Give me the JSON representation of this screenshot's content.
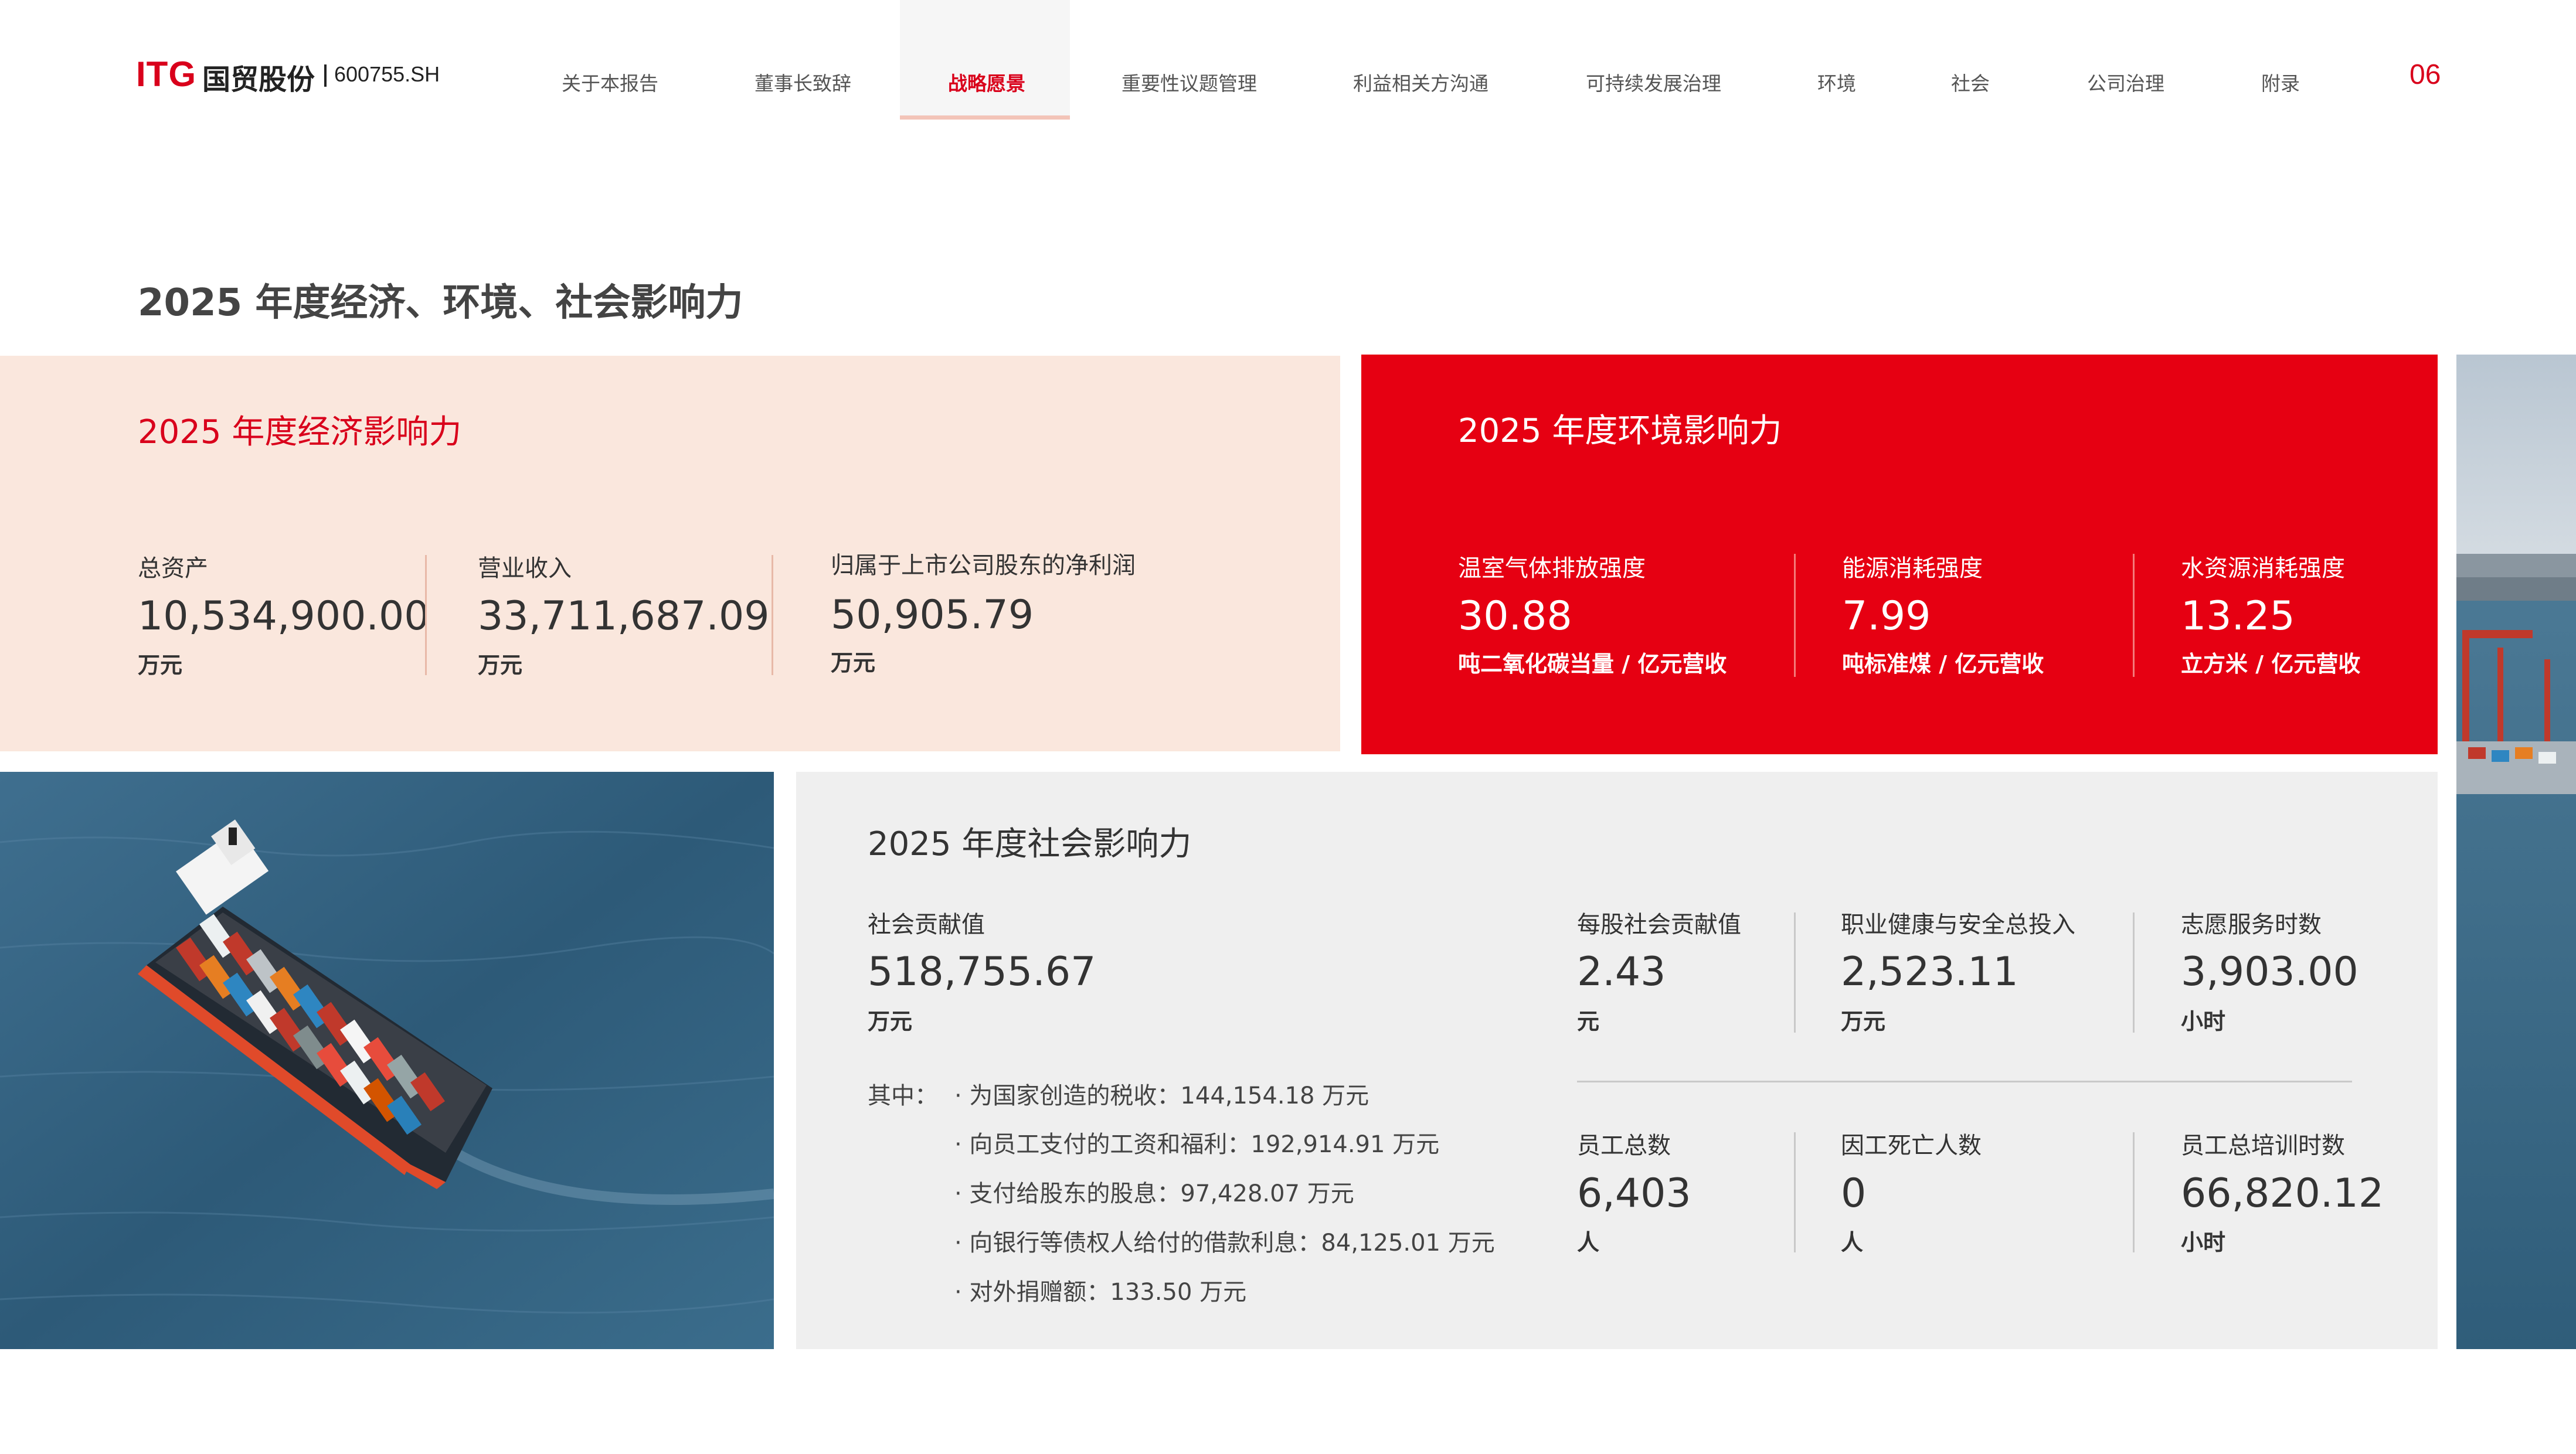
{
  "header": {
    "logo_mark": "ITG",
    "logo_name": "国贸股份",
    "stock_code": "600755.SH",
    "page_number": "06",
    "nav": [
      {
        "label": "关于本报告"
      },
      {
        "label": "董事长致辞"
      },
      {
        "label": "战略愿景",
        "active": true
      },
      {
        "label": "重要性议题管理"
      },
      {
        "label": "利益相关方沟通"
      },
      {
        "label": "可持续发展治理"
      },
      {
        "label": "环境"
      },
      {
        "label": "社会"
      },
      {
        "label": "公司治理"
      },
      {
        "label": "附录"
      }
    ]
  },
  "page_title": "2025 年度经济、环境、社会影响力",
  "economic": {
    "title": "2025 年度经济影响力",
    "metrics": [
      {
        "label": "总资产",
        "value": "10,534,900.00",
        "unit": "万元"
      },
      {
        "label": "营业收入",
        "value": "33,711,687.09",
        "unit": "万元"
      },
      {
        "label": "归属于上市公司股东的净利润",
        "value": "50,905.79",
        "unit": "万元"
      }
    ]
  },
  "environmental": {
    "title": "2025 年度环境影响力",
    "metrics": [
      {
        "label": "温室气体排放强度",
        "value": "30.88",
        "unit": "吨二氧化碳当量 / 亿元营收"
      },
      {
        "label": "能源消耗强度",
        "value": "7.99",
        "unit": "吨标准煤 / 亿元营收"
      },
      {
        "label": "水资源消耗强度",
        "value": "13.25",
        "unit": "立方米 / 亿元营收"
      }
    ]
  },
  "social": {
    "title": "2025 年度社会影响力",
    "contribution": {
      "label": "社会贡献值",
      "value": "518,755.67",
      "unit": "万元"
    },
    "breakdown_prefix": "其中：",
    "breakdown": [
      "· 为国家创造的税收：144,154.18 万元",
      "· 向员工支付的工资和福利：192,914.91 万元",
      "· 支付给股东的股息：97,428.07 万元",
      "· 向银行等债权人给付的借款利息：84,125.01 万元",
      "· 对外捐赠额：133.50 万元"
    ],
    "metrics_top": [
      {
        "label": "每股社会贡献值",
        "value": "2.43",
        "unit": "元"
      },
      {
        "label": "职业健康与安全总投入",
        "value": "2,523.11",
        "unit": "万元"
      },
      {
        "label": "志愿服务时数",
        "value": "3,903.00",
        "unit": "小时"
      }
    ],
    "metrics_bottom": [
      {
        "label": "员工总数",
        "value": "6,403",
        "unit": "人"
      },
      {
        "label": "因工死亡人数",
        "value": "0",
        "unit": "人"
      },
      {
        "label": "员工总培训时数",
        "value": "66,820.12",
        "unit": "小时"
      }
    ]
  },
  "colors": {
    "brand_red": "#d9001b",
    "env_red": "#e60012",
    "econ_bg": "#fae7dd",
    "social_bg": "#efefef"
  }
}
